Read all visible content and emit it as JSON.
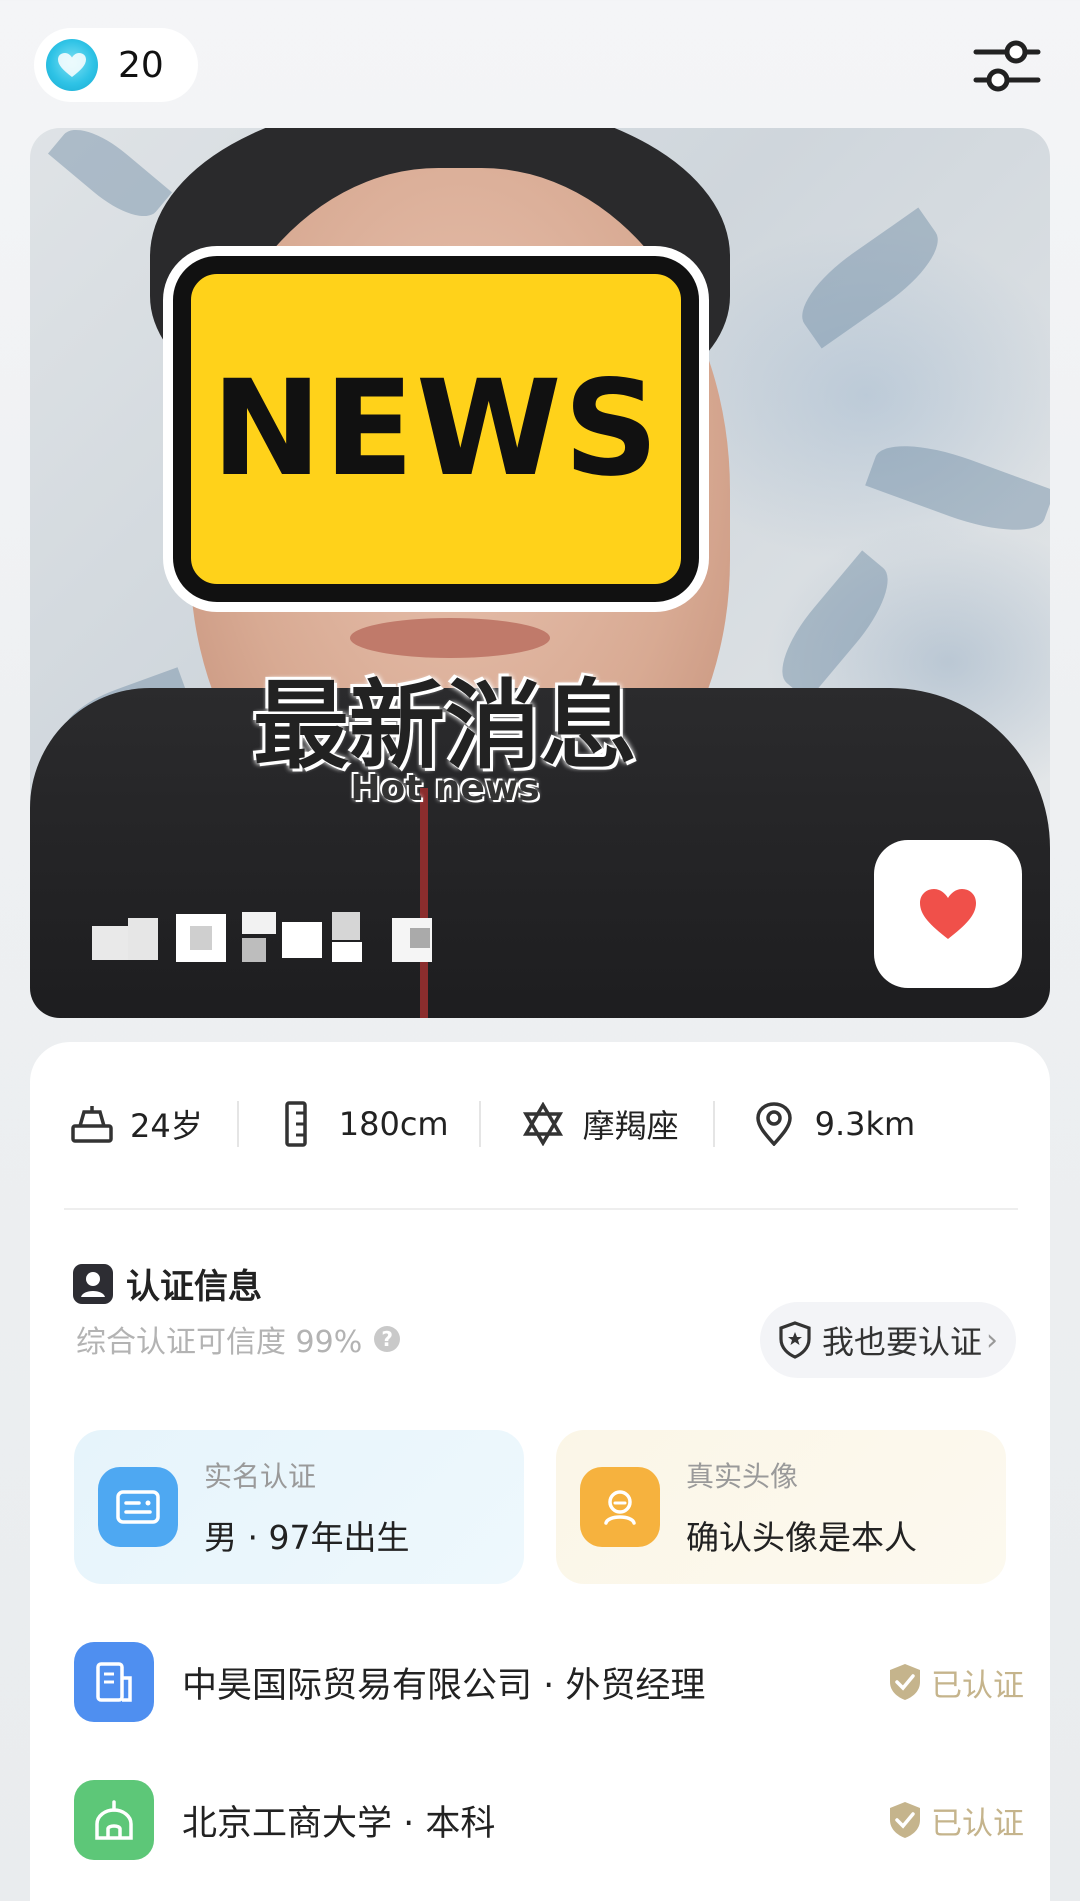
{
  "header": {
    "gem_count": "20",
    "gem_icon": "diamond-icon",
    "filter_icon": "filter-sliders-icon"
  },
  "photo": {
    "sticker_text": "NEWS",
    "caption_cn": "最新消息",
    "caption_en": "Hot news",
    "like_icon": "heart-icon",
    "accent_heart": "#f0504a",
    "sticker_color": "#ffd21a"
  },
  "stats": [
    {
      "icon": "age-icon",
      "text": "24岁"
    },
    {
      "icon": "height-ruler-icon",
      "text": "180cm"
    },
    {
      "icon": "zodiac-star-icon",
      "text": "摩羯座"
    },
    {
      "icon": "location-pin-icon",
      "text": "9.3km"
    }
  ],
  "certification": {
    "title": "认证信息",
    "subtitle": "综合认证可信度 99%",
    "verify_button": "我也要认证",
    "tiles": [
      {
        "label": "实名认证",
        "value": "男 · 97年出生",
        "color": "#4ea8f2",
        "icon": "id-card-icon"
      },
      {
        "label": "真实头像",
        "value": "确认头像是本人",
        "color": "#f6b23e",
        "icon": "avatar-icon"
      }
    ],
    "rows": [
      {
        "text": "中昊国际贸易有限公司 · 外贸经理",
        "badge": "已认证",
        "icon": "company-icon",
        "color": "#4f8ff0"
      },
      {
        "text": "北京工商大学 · 本科",
        "badge": "已认证",
        "icon": "school-icon",
        "color": "#5dc778"
      }
    ]
  }
}
